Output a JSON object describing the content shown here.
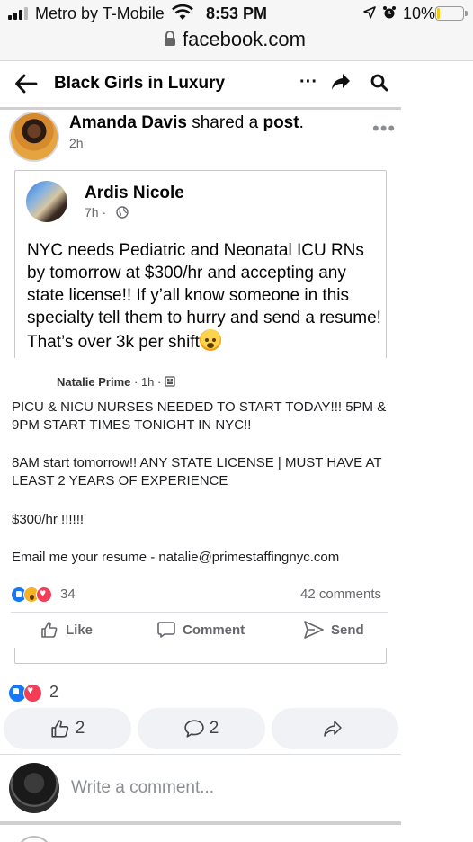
{
  "status_bar": {
    "carrier": "Metro by T-Mobile",
    "time": "8:53 PM",
    "battery": "10%",
    "battery_level": 0.1,
    "battery_color": "#f6c90e"
  },
  "browser": {
    "url": "facebook.com"
  },
  "group_header": {
    "title": "Black Girls in Luxury",
    "more_label": "···"
  },
  "post": {
    "author": "Amanda Davis",
    "action_text": "shared a",
    "object_text": "post",
    "period": ".",
    "time": "2h",
    "more_label": "•••"
  },
  "shared_post": {
    "author": "Ardis Nicole",
    "time": "7h",
    "time_separator": "·",
    "body": "NYC needs Pediatric and Neonatal ICU RNs by tomorrow at $300/hr and accepting any state license!! If y’all know someone in this specialty tell them to hurry and send a resume! That’s over 3k per shift",
    "emoji": "exploding-head-emoji"
  },
  "embedded_post": {
    "author": "Natalie Prime",
    "meta": "· 1h ·",
    "paragraphs": [
      "PICU & NICU NURSES NEEDED TO START TODAY!!! 5PM & 9PM START TIMES TONIGHT IN NYC!!",
      "8AM start tomorrow!! ANY STATE LICENSE | MUST HAVE AT LEAST 2 YEARS OF EXPERIENCE",
      "$300/hr !!!!!!",
      "Email me your resume - natalie@primestaffingnyc.com"
    ],
    "reaction_count": "34",
    "comments": "42 comments",
    "actions": {
      "like": "Like",
      "comment": "Comment",
      "send": "Send"
    }
  },
  "outer_post_footer": {
    "reaction_count": "2",
    "like_count": "2",
    "comment_count": "2"
  },
  "comment_box": {
    "placeholder": "Write a comment..."
  },
  "colors": {
    "facebook_blue": "#1877f2",
    "love_red": "#f33e58",
    "wow_yellow": "#f7b125"
  }
}
